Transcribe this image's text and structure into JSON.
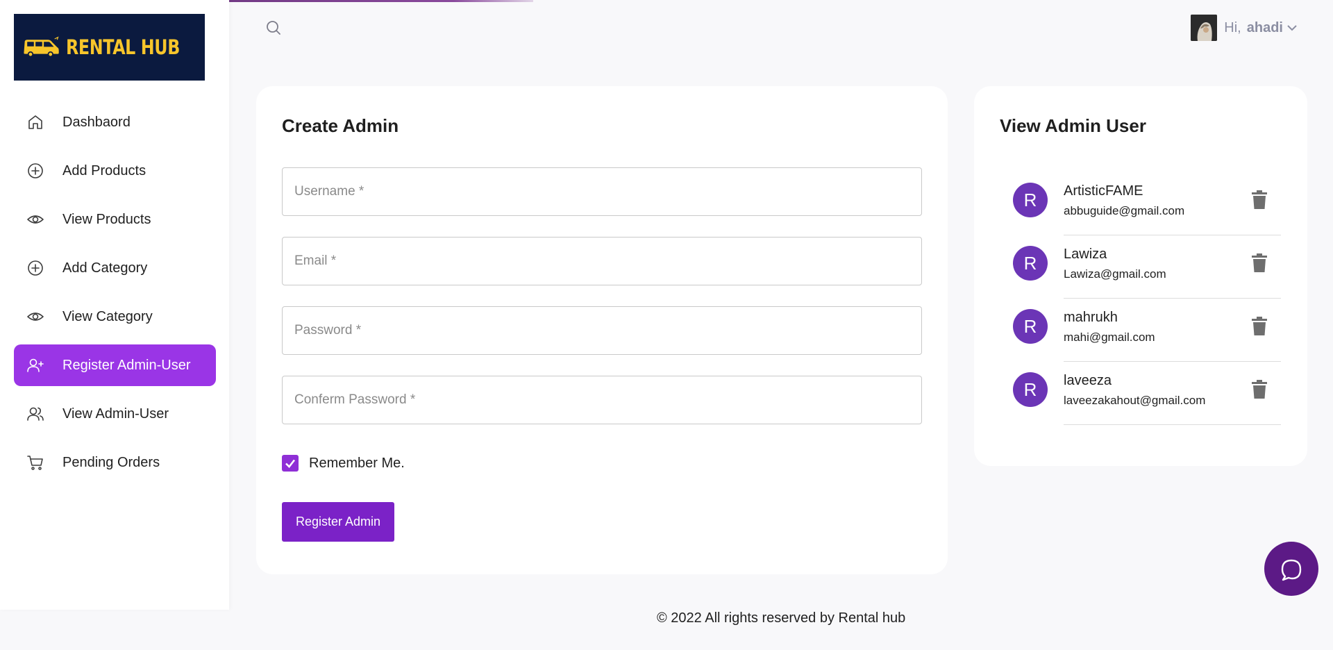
{
  "brand": {
    "logo_text": "RENTAL HUB",
    "logo_bg": "#0b1a3f",
    "logo_color": "#f7c52b"
  },
  "sidebar": {
    "items": [
      {
        "label": "Dashbaord",
        "icon": "home-icon",
        "active": false
      },
      {
        "label": "Add Products",
        "icon": "plus-circle-icon",
        "active": false
      },
      {
        "label": "View Products",
        "icon": "eye-icon",
        "active": false
      },
      {
        "label": "Add Category",
        "icon": "plus-circle-icon",
        "active": false
      },
      {
        "label": "View Category",
        "icon": "eye-icon",
        "active": false
      },
      {
        "label": "Register Admin-User",
        "icon": "user-plus-icon",
        "active": true
      },
      {
        "label": "View Admin-User",
        "icon": "users-icon",
        "active": false
      },
      {
        "label": "Pending Orders",
        "icon": "cart-icon",
        "active": false
      }
    ],
    "active_color": "#9a35e6"
  },
  "header": {
    "search_icon": "search-icon",
    "greeting": "Hi,",
    "username": "ahadi"
  },
  "create_admin": {
    "title": "Create Admin",
    "username_placeholder": "Username *",
    "email_placeholder": "Email *",
    "password_placeholder": "Password *",
    "confirm_placeholder": "Conferm Password *",
    "remember_label": "Remember Me.",
    "remember_checked": true,
    "submit_label": "Register Admin",
    "button_color": "#7b22c7"
  },
  "view_admin": {
    "title": "View Admin User",
    "users": [
      {
        "initial": "R",
        "name": "ArtisticFAME",
        "email": "abbuguide@gmail.com"
      },
      {
        "initial": "R",
        "name": "Lawiza",
        "email": "Lawiza@gmail.com"
      },
      {
        "initial": "R",
        "name": "mahrukh",
        "email": "mahi@gmail.com"
      },
      {
        "initial": "R",
        "name": "laveeza",
        "email": "laveezakahout@gmail.com"
      }
    ],
    "avatar_color": "#6b35b6"
  },
  "footer": {
    "text": "© 2022 All rights reserved by Rental hub"
  },
  "chat": {
    "icon": "chat-bubble-icon",
    "color": "#5c1a86"
  }
}
